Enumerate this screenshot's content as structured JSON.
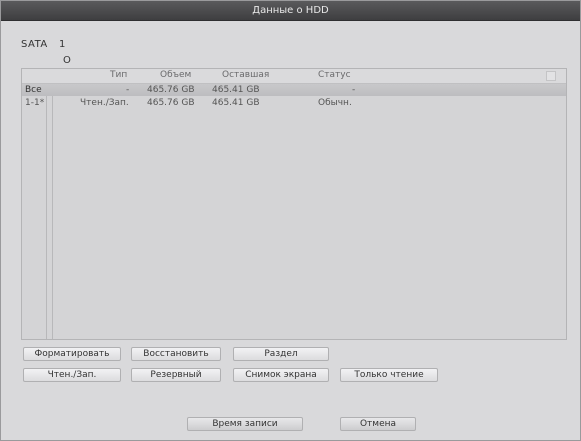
{
  "window": {
    "title": "Данные о HDD"
  },
  "disk": {
    "label": "SATA",
    "number": "1",
    "status": "O"
  },
  "table": {
    "headers": [
      "Тип",
      "Объем",
      "Оставшая",
      "Статус"
    ],
    "rows": [
      {
        "id": "Все",
        "type": "-",
        "capacity": "465.76 GB",
        "remaining": "465.41 GB",
        "status": "-"
      },
      {
        "id": "1-1*",
        "type": "Чтен./Зап.",
        "capacity": "465.76 GB",
        "remaining": "465.41 GB",
        "status": "Обычн."
      }
    ]
  },
  "buttons": {
    "format": "Форматировать",
    "restore": "Восстановить",
    "partition": "Раздел",
    "read_write": "Чтен./Зап.",
    "backup": "Резервный",
    "snapshot": "Снимок экрана",
    "read_only": "Только чтение",
    "record_time": "Время записи",
    "cancel": "Отмена"
  }
}
